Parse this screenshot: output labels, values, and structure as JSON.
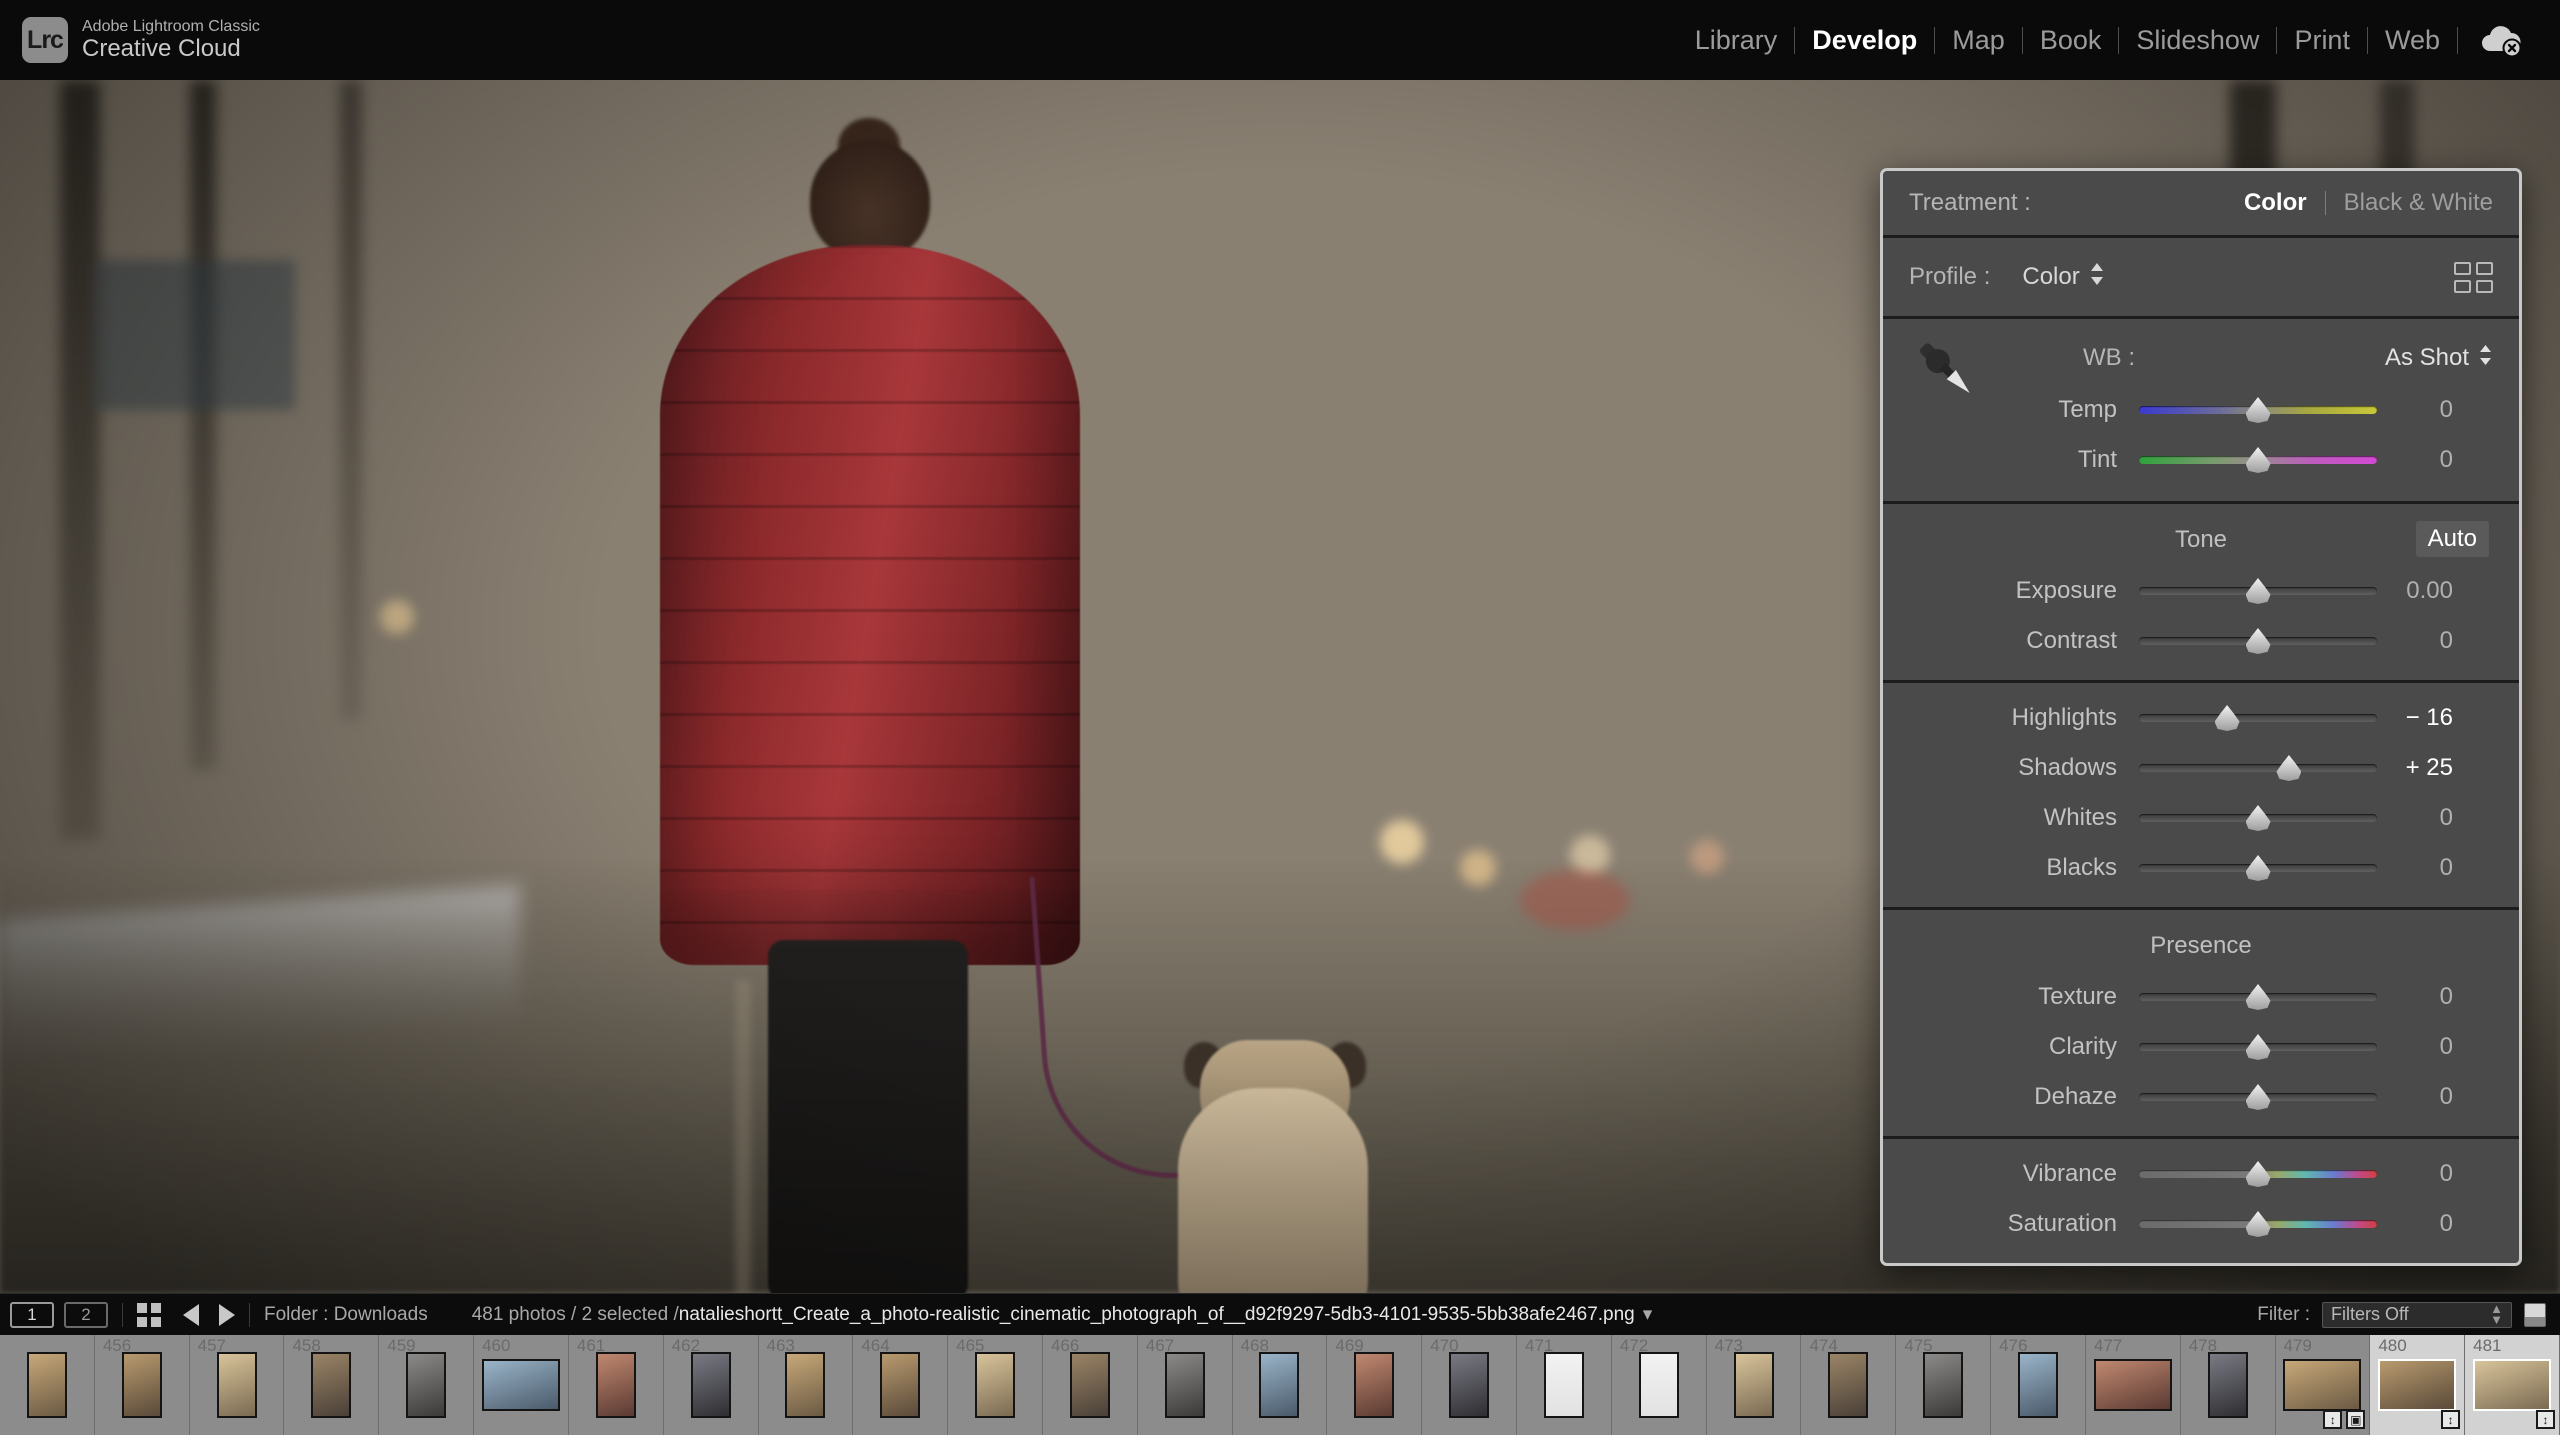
{
  "app": {
    "logo_text": "Lrc",
    "product": "Adobe Lightroom Classic",
    "suite": "Creative Cloud"
  },
  "modules": [
    {
      "label": "Library",
      "active": false
    },
    {
      "label": "Develop",
      "active": true
    },
    {
      "label": "Map",
      "active": false
    },
    {
      "label": "Book",
      "active": false
    },
    {
      "label": "Slideshow",
      "active": false
    },
    {
      "label": "Print",
      "active": false
    },
    {
      "label": "Web",
      "active": false
    }
  ],
  "cloud_icon": "cloud-sync-off-icon",
  "panel": {
    "treatment": {
      "label": "Treatment :",
      "options": [
        {
          "label": "Color",
          "active": true
        },
        {
          "label": "Black & White",
          "active": false
        }
      ]
    },
    "profile": {
      "label": "Profile :",
      "value": "Color",
      "browser_icon": "profile-grid-icon"
    },
    "white_balance": {
      "eyedropper_icon": "eyedropper-icon",
      "label": "WB :",
      "value": "As Shot",
      "sliders": [
        {
          "name": "Temp",
          "value": "0",
          "pos": 50,
          "track": "temp",
          "modified": false
        },
        {
          "name": "Tint",
          "value": "0",
          "pos": 50,
          "track": "tint",
          "modified": false
        }
      ]
    },
    "tone": {
      "title": "Tone",
      "auto_label": "Auto",
      "sliders": [
        {
          "name": "Exposure",
          "value": "0.00",
          "pos": 50,
          "track": "plain",
          "modified": false
        },
        {
          "name": "Contrast",
          "value": "0",
          "pos": 50,
          "track": "plain",
          "modified": false
        }
      ]
    },
    "tone_detail": {
      "sliders": [
        {
          "name": "Highlights",
          "value": "− 16",
          "pos": 37,
          "track": "plain",
          "modified": true
        },
        {
          "name": "Shadows",
          "value": "+ 25",
          "pos": 63,
          "track": "plain",
          "modified": true
        },
        {
          "name": "Whites",
          "value": "0",
          "pos": 50,
          "track": "plain",
          "modified": false
        },
        {
          "name": "Blacks",
          "value": "0",
          "pos": 50,
          "track": "plain",
          "modified": false
        }
      ]
    },
    "presence": {
      "title": "Presence",
      "sliders": [
        {
          "name": "Texture",
          "value": "0",
          "pos": 50,
          "track": "plain",
          "modified": false
        },
        {
          "name": "Clarity",
          "value": "0",
          "pos": 50,
          "track": "plain",
          "modified": false
        },
        {
          "name": "Dehaze",
          "value": "0",
          "pos": 50,
          "track": "plain",
          "modified": false
        }
      ]
    },
    "color_mix": {
      "sliders": [
        {
          "name": "Vibrance",
          "value": "0",
          "pos": 50,
          "track": "vib",
          "modified": false
        },
        {
          "name": "Saturation",
          "value": "0",
          "pos": 50,
          "track": "vib",
          "modified": false
        }
      ]
    }
  },
  "toolbar": {
    "monitor_1": "1",
    "monitor_2": "2",
    "grid_icon": "grid-view-icon",
    "prev_icon": "arrow-left-icon",
    "next_icon": "arrow-right-icon",
    "folder_label": "Folder : Downloads",
    "photo_count": "481 photos / 2 selected /",
    "filename": "natalieshortt_Create_a_photo-realistic_cinematic_photograph_of__d92f9297-5db3-4101-9535-5bb38afe2467.png",
    "filename_caret": "▾",
    "filter_label": "Filter :",
    "filter_value": "Filters Off"
  },
  "filmstrip": {
    "items": [
      {
        "num": "",
        "kind": "portrait-wide",
        "selected": false,
        "badges": []
      },
      {
        "num": "456",
        "kind": "portrait",
        "selected": false,
        "badges": []
      },
      {
        "num": "457",
        "kind": "portrait",
        "selected": false,
        "badges": []
      },
      {
        "num": "458",
        "kind": "portrait",
        "selected": false,
        "badges": []
      },
      {
        "num": "459",
        "kind": "portrait",
        "selected": false,
        "badges": []
      },
      {
        "num": "460",
        "kind": "landscape",
        "selected": false,
        "badges": []
      },
      {
        "num": "461",
        "kind": "portrait",
        "selected": false,
        "badges": []
      },
      {
        "num": "462",
        "kind": "portrait",
        "selected": false,
        "badges": []
      },
      {
        "num": "463",
        "kind": "portrait",
        "selected": false,
        "badges": []
      },
      {
        "num": "464",
        "kind": "portrait",
        "selected": false,
        "badges": []
      },
      {
        "num": "465",
        "kind": "portrait",
        "selected": false,
        "badges": []
      },
      {
        "num": "466",
        "kind": "portrait",
        "selected": false,
        "badges": []
      },
      {
        "num": "467",
        "kind": "portrait",
        "selected": false,
        "badges": []
      },
      {
        "num": "468",
        "kind": "portrait",
        "selected": false,
        "badges": []
      },
      {
        "num": "469",
        "kind": "portrait",
        "selected": false,
        "badges": []
      },
      {
        "num": "470",
        "kind": "portrait",
        "selected": false,
        "badges": []
      },
      {
        "num": "471",
        "kind": "portrait-light",
        "selected": false,
        "badges": []
      },
      {
        "num": "472",
        "kind": "portrait-light",
        "selected": false,
        "badges": []
      },
      {
        "num": "473",
        "kind": "portrait",
        "selected": false,
        "badges": []
      },
      {
        "num": "474",
        "kind": "portrait",
        "selected": false,
        "badges": []
      },
      {
        "num": "475",
        "kind": "portrait",
        "selected": false,
        "badges": []
      },
      {
        "num": "476",
        "kind": "portrait",
        "selected": false,
        "badges": []
      },
      {
        "num": "477",
        "kind": "landscape",
        "selected": false,
        "badges": []
      },
      {
        "num": "478",
        "kind": "portrait",
        "selected": false,
        "badges": []
      },
      {
        "num": "479",
        "kind": "landscape",
        "selected": false,
        "badges": [
          "crop-icon",
          "adjust-icon"
        ]
      },
      {
        "num": "480",
        "kind": "landscape",
        "selected": true,
        "badges": [
          "adjust-icon"
        ]
      },
      {
        "num": "481",
        "kind": "landscape",
        "selected": true,
        "badges": [
          "adjust-icon"
        ]
      }
    ]
  }
}
